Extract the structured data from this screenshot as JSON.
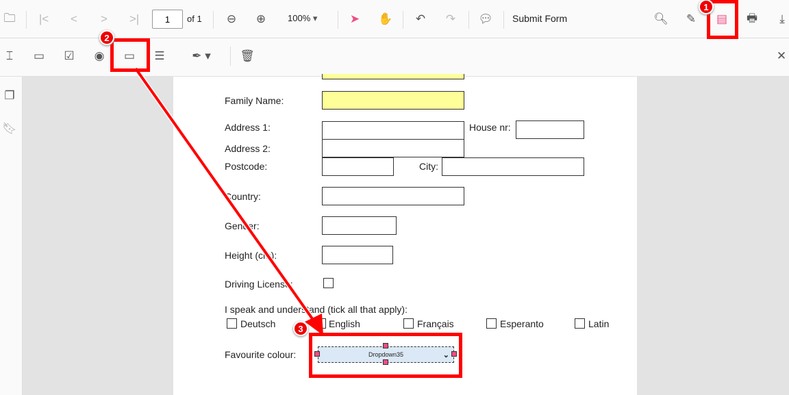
{
  "toolbar": {
    "page_current": "1",
    "page_of": "of 1",
    "zoom": "100%",
    "submit_label": "Submit Form"
  },
  "form": {
    "family_name": "Family Name:",
    "address1": "Address 1:",
    "house_nr": "House nr:",
    "address2": "Address 2:",
    "postcode": "Postcode:",
    "city": "City:",
    "country": "Country:",
    "gender": "Gender:",
    "height": "Height (cm):",
    "driving": "Driving License:",
    "speak": "I speak and understand (tick all that apply):",
    "languages": [
      "Deutsch",
      "English",
      "Français",
      "Esperanto",
      "Latin"
    ],
    "fav_colour": "Favourite colour:",
    "dropdown_value": "Dropdown35"
  },
  "annotations": {
    "badge1": "1",
    "badge2": "2",
    "badge3": "3",
    "color": "#ff0000"
  }
}
